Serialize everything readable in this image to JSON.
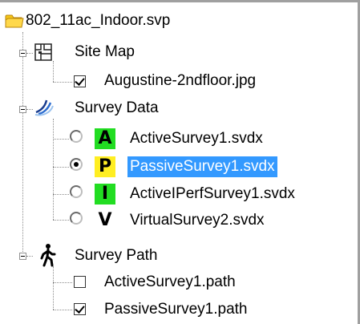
{
  "tree": {
    "root": {
      "label": "802_11ac_Indoor.svp",
      "icon": "folder-icon"
    },
    "site_map": {
      "label": "Site Map",
      "icon": "site-map-icon",
      "items": [
        {
          "label": "Augustine-2ndfloor.jpg",
          "checked": true
        }
      ]
    },
    "survey_data": {
      "label": "Survey Data",
      "icon": "survey-data-icon",
      "items": [
        {
          "letter": "A",
          "badge_color": "#22dd22",
          "label": "ActiveSurvey1.svdx",
          "selected_radio": false,
          "highlighted": false
        },
        {
          "letter": "P",
          "badge_color": "#ffee22",
          "label": "PassiveSurvey1.svdx",
          "selected_radio": true,
          "highlighted": true
        },
        {
          "letter": "I",
          "badge_color": "#22dd22",
          "label": "ActiveIPerfSurvey1.svdx",
          "selected_radio": false,
          "highlighted": false
        },
        {
          "letter": "V",
          "badge_color": "#ffffff",
          "label": "VirtualSurvey2.svdx",
          "selected_radio": false,
          "highlighted": false
        }
      ]
    },
    "survey_path": {
      "label": "Survey Path",
      "icon": "walking-person-icon",
      "items": [
        {
          "label": "ActiveSurvey1.path",
          "checked": false
        },
        {
          "label": "PassiveSurvey1.path",
          "checked": true
        }
      ]
    }
  },
  "colors": {
    "selection": "#3399ff",
    "folder": "#f5c518"
  }
}
